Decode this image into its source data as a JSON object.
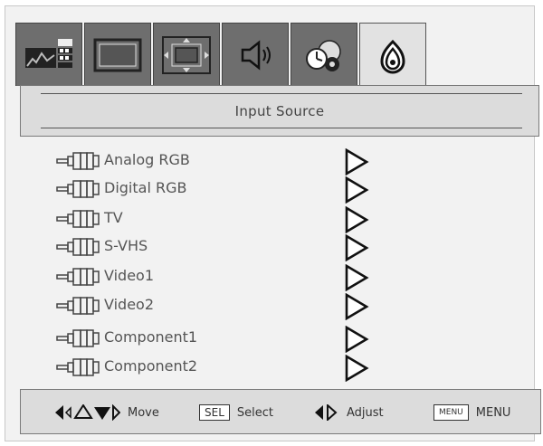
{
  "tabs": [
    {
      "name": "picture-settings-icon",
      "active": false
    },
    {
      "name": "screen-aspect-icon",
      "active": false
    },
    {
      "name": "image-position-icon",
      "active": false
    },
    {
      "name": "audio-speaker-icon",
      "active": false
    },
    {
      "name": "options-gear-icon",
      "active": false
    },
    {
      "name": "input-source-icon",
      "active": true
    }
  ],
  "header": {
    "title": "Input Source"
  },
  "sources": [
    {
      "label": "Analog RGB"
    },
    {
      "label": "Digital RGB"
    },
    {
      "label": "TV"
    },
    {
      "label": "S-VHS"
    },
    {
      "label": "Video1"
    },
    {
      "label": "Video2"
    },
    {
      "label": "Component1"
    },
    {
      "label": "Component2"
    }
  ],
  "footer": {
    "move_label": "Move",
    "sel_key": "SEL",
    "select_label": "Select",
    "adjust_label": "Adjust",
    "menu_key": "MENU",
    "menu_label": "MENU"
  },
  "colors": {
    "tab_inactive": "#6e6e6e",
    "tab_active": "#e2e2e2",
    "bar_bg": "#dcdcdc"
  }
}
